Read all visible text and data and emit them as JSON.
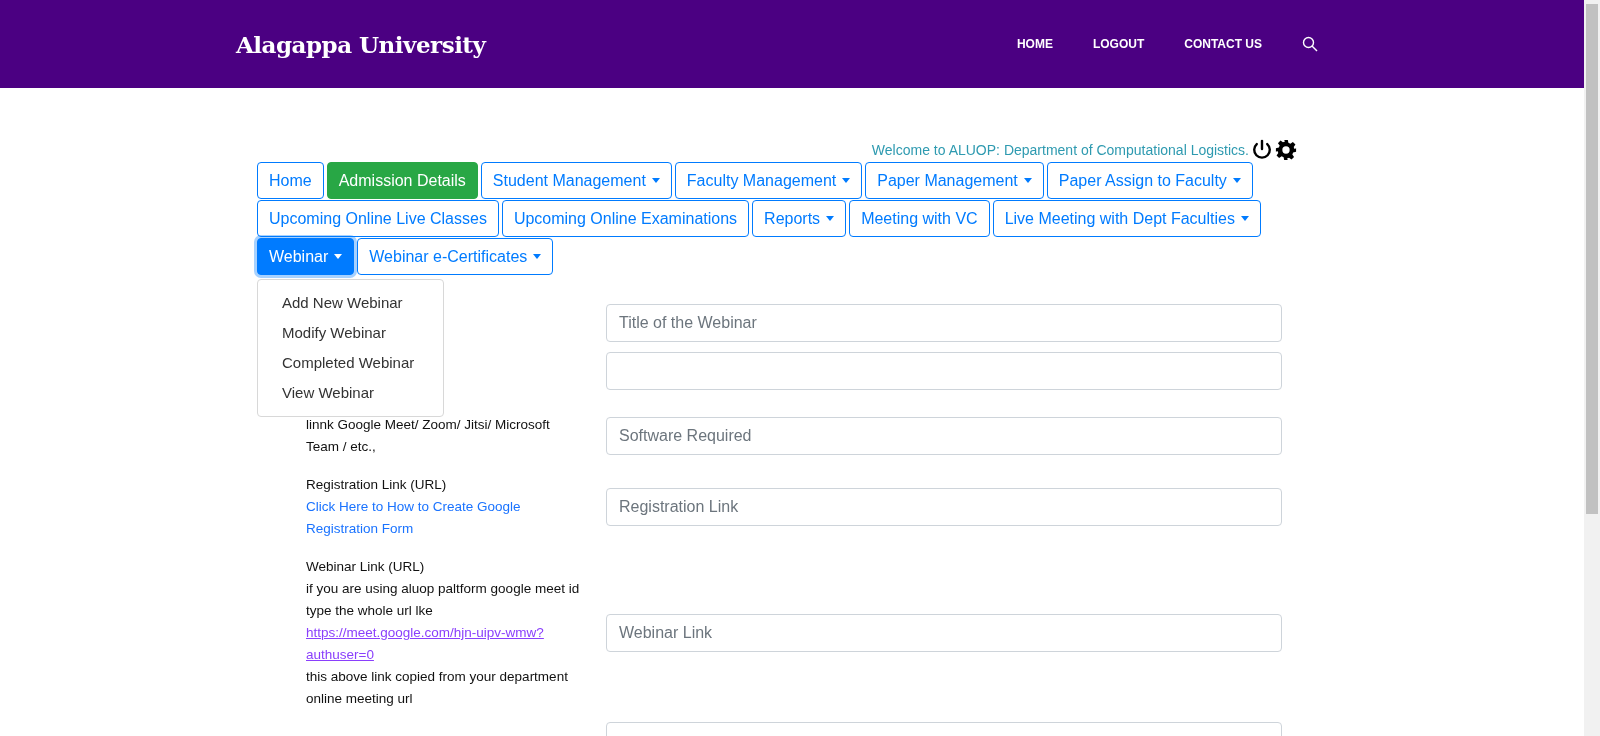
{
  "header": {
    "brand": "Alagappa University",
    "nav": [
      "HOME",
      "LOGOUT",
      "CONTACT US"
    ]
  },
  "welcome": "Welcome to ALUOP: Department of Computational Logistics.",
  "menu_rows": [
    [
      {
        "label": "Home",
        "kind": "outline",
        "dropdown": false
      },
      {
        "label": "Admission Details",
        "kind": "success",
        "dropdown": false
      },
      {
        "label": "Student Management",
        "kind": "outline",
        "dropdown": true
      },
      {
        "label": "Faculty Management",
        "kind": "outline",
        "dropdown": true
      },
      {
        "label": "Paper Management",
        "kind": "outline",
        "dropdown": true
      },
      {
        "label": "Paper Assign to Faculty ",
        "kind": "outline",
        "dropdown": true
      }
    ],
    [
      {
        "label": "Upcoming Online Live Classes",
        "kind": "outline",
        "dropdown": false
      },
      {
        "label": "Upcoming Online Examinations",
        "kind": "outline",
        "dropdown": false
      },
      {
        "label": "Reports",
        "kind": "outline",
        "dropdown": true
      },
      {
        "label": "Meeting with VC",
        "kind": "outline",
        "dropdown": false
      },
      {
        "label": "Live Meeting with Dept Faculties",
        "kind": "outline",
        "dropdown": true
      }
    ],
    [
      {
        "label": "Webinar",
        "kind": "active",
        "dropdown": true
      },
      {
        "label": "Webinar e-Certificates",
        "kind": "outline",
        "dropdown": true
      }
    ]
  ],
  "open_menu": [
    "Add New Webinar",
    "Modify Webinar",
    "Completed Webinar",
    "View Webinar"
  ],
  "form_rows": [
    {
      "label": [],
      "placeholder": "Title of the Webinar"
    },
    {
      "label": []
    },
    {
      "label": [
        {
          "kind": "text",
          "text": "linnk Google Meet/ Zoom/ Jitsi/ Microsoft Team / etc.,"
        }
      ],
      "placeholder": "Software Required"
    },
    {
      "label": [
        {
          "kind": "text",
          "text": "Registration Link (URL)"
        },
        {
          "kind": "link",
          "text": "Click Here to How to Create Google Registration Form"
        }
      ],
      "placeholder": "Registration Link"
    },
    {
      "label": [
        {
          "kind": "text",
          "text": "Webinar Link (URL)"
        },
        {
          "kind": "text",
          "text": "if you are using aluop paltform google meet id type the whole url lke"
        },
        {
          "kind": "visited_link",
          "text": "https://meet.google.com/hjn-uipv-wmw?authuser=0"
        },
        {
          "kind": "text",
          "text": "this above link copied from your department online meeting url"
        }
      ],
      "placeholder": "Webinar Link"
    },
    {
      "label": []
    }
  ]
}
